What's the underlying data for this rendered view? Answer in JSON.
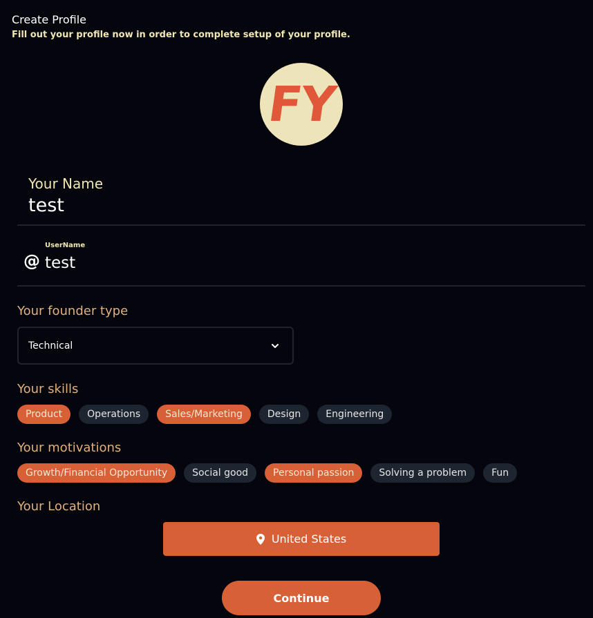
{
  "header": {
    "title": "Create Profile",
    "subtitle": "Fill out your profile now in order to complete setup of your profile."
  },
  "avatar": {
    "initials": "FY",
    "background": "#ede5b9",
    "text_color": "#e0573a"
  },
  "name_field": {
    "label": "Your Name",
    "value": "test"
  },
  "username_field": {
    "icon": "at-icon",
    "label": "UserName",
    "value": "test"
  },
  "founder_type": {
    "label": "Your founder type",
    "selected": "Technical",
    "icon": "chevron-down-icon"
  },
  "skills": {
    "label": "Your skills",
    "items": [
      {
        "label": "Product",
        "selected": true
      },
      {
        "label": "Operations",
        "selected": false
      },
      {
        "label": "Sales/Marketing",
        "selected": true
      },
      {
        "label": "Design",
        "selected": false
      },
      {
        "label": "Engineering",
        "selected": false
      }
    ]
  },
  "motivations": {
    "label": "Your motivations",
    "items": [
      {
        "label": "Growth/Financial Opportunity",
        "selected": true
      },
      {
        "label": "Social good",
        "selected": false
      },
      {
        "label": "Personal passion",
        "selected": true
      },
      {
        "label": "Solving a problem",
        "selected": false
      },
      {
        "label": "Fun",
        "selected": false
      }
    ]
  },
  "location": {
    "label": "Your Location",
    "value": "United States",
    "icon": "location-pin-icon"
  },
  "continue_label": "Continue",
  "colors": {
    "background": "#05060d",
    "accent": "#d86036",
    "chip_unselected": "#1c2530",
    "label_gold": "#e0b07e",
    "label_cream": "#f0e6b4"
  }
}
